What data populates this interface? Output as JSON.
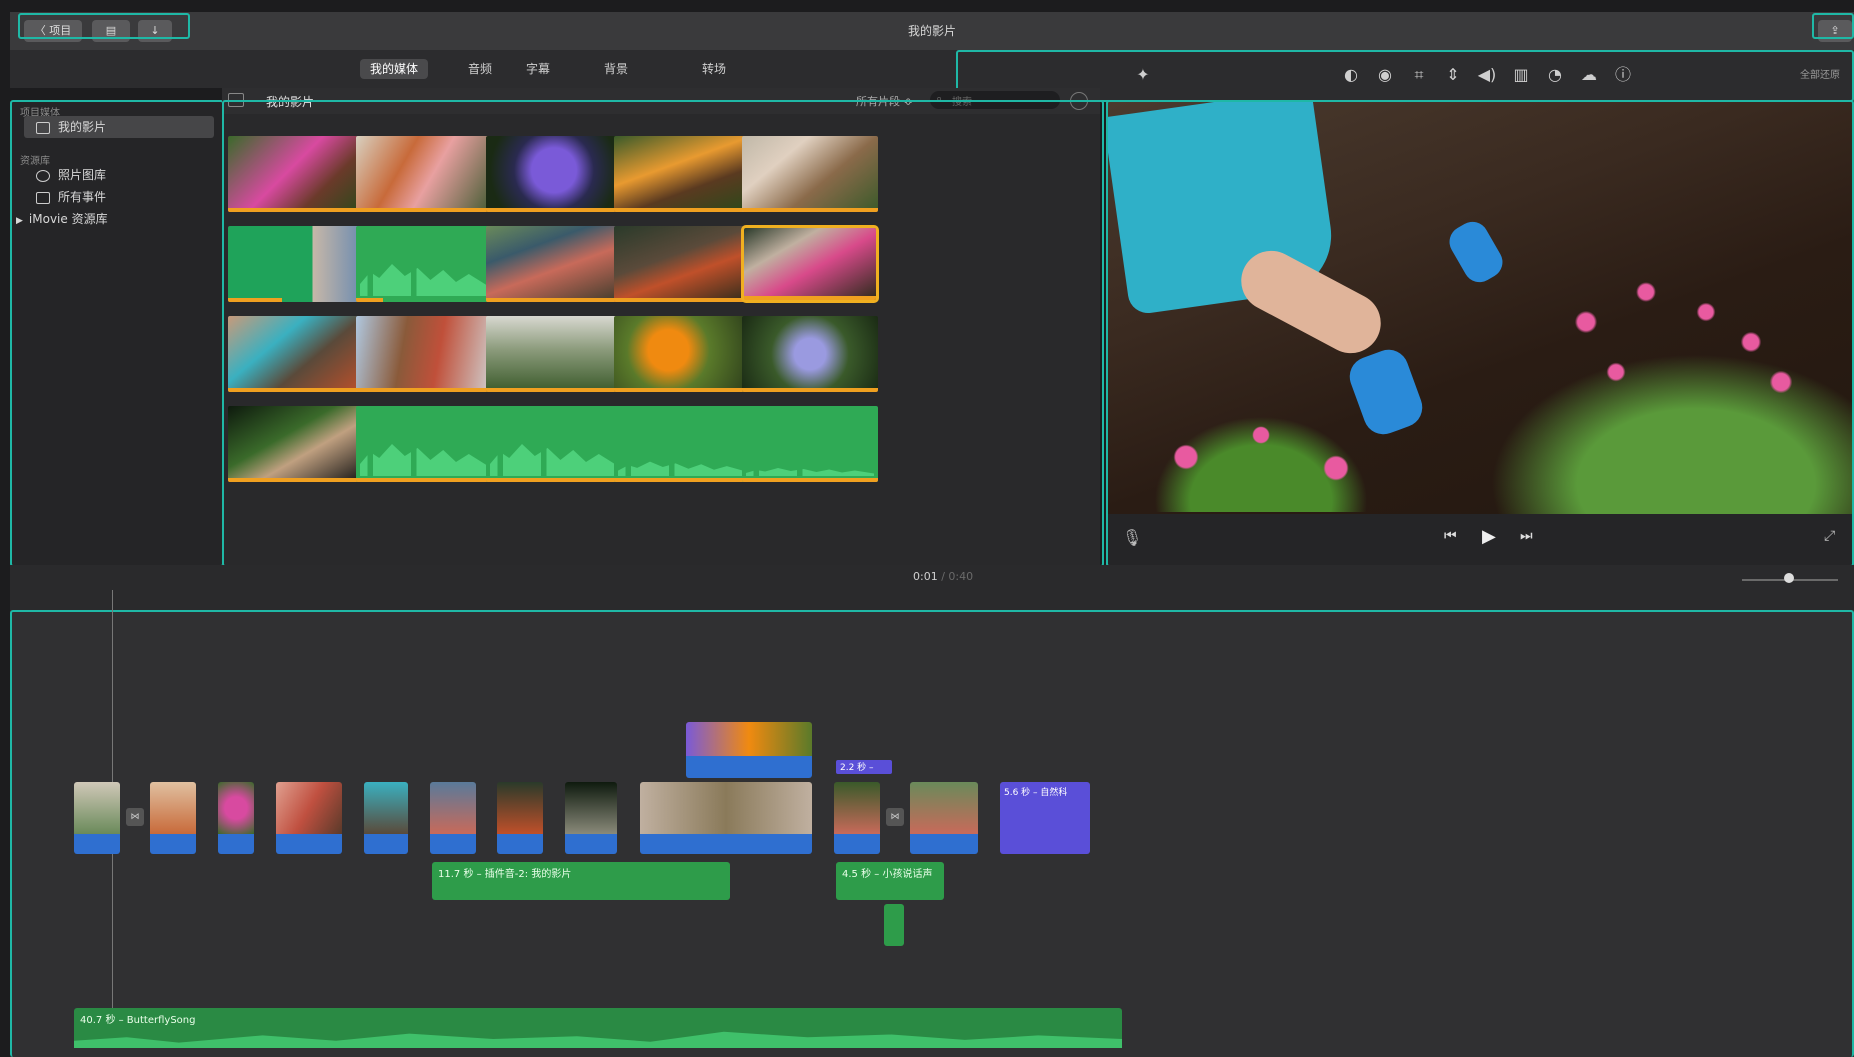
{
  "titlebar": {
    "back_label": "〈 项目",
    "title": "我的影片"
  },
  "tabs": [
    {
      "label": "我的媒体",
      "active": true
    },
    {
      "label": "音频",
      "active": false
    },
    {
      "label": "字幕",
      "active": false
    },
    {
      "label": "背景",
      "active": false
    },
    {
      "label": "转场",
      "active": false
    }
  ],
  "browser": {
    "heading": "我的影片",
    "filter": "所有片段 ≎",
    "search_placeholder": "搜索"
  },
  "viewer_toolbar": {
    "reset_label": "全部还原",
    "icons": [
      "magic-wand-icon",
      "color-balance-icon",
      "color-correction-icon",
      "crop-icon",
      "stabilization-icon",
      "volume-icon",
      "noise-reduction-icon",
      "speed-icon",
      "clip-filter-icon",
      "info-icon"
    ]
  },
  "sidebar": {
    "section1": "项目媒体",
    "item_project": "我的影片",
    "section2": "资源库",
    "item_photos": "照片图库",
    "item_events": "所有事件",
    "item_library": "iMovie 资源库"
  },
  "player": {
    "time_current": "0:01",
    "time_total": "/ 0:40"
  },
  "timeline": {
    "clip_label_1": "11.7 秒 – 插件音-2: 我的影片",
    "clip_label_2": "4.5 秒 – 小孩说话声",
    "title_clip": "5.6 秒 – 自然科",
    "cut_label": "2.2 秒 –",
    "music_label": "40.7 秒 – ButterflySong"
  },
  "colors": {
    "accent": "#1fb8a6",
    "selection": "#f0b020",
    "audio_green": "#2e9c4a",
    "video_blue": "#2f6fd0",
    "title_purple": "#5a4fd8"
  }
}
